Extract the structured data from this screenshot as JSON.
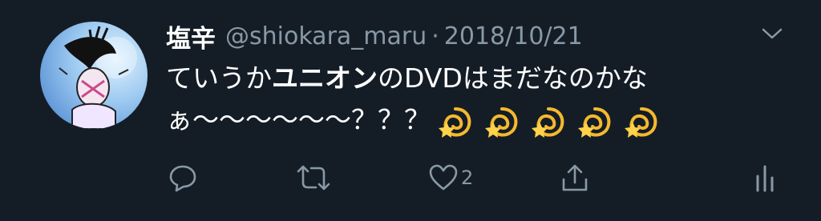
{
  "tweet": {
    "display_name": "塩辛",
    "handle": "@shiokara_maru",
    "separator": "·",
    "date": "2018/10/21",
    "text_line1_prefix": "ていうか",
    "text_line1_bold": "ユニオン",
    "text_line1_suffix": "のDVDはまだなのかな",
    "text_line2": "ぁ〜〜〜〜〜〜？？？",
    "emojis": [
      "dizzy-emoji",
      "dizzy-emoji",
      "dizzy-emoji",
      "dizzy-emoji",
      "dizzy-emoji"
    ]
  },
  "actions": {
    "reply_icon": "reply-icon",
    "retweet_icon": "retweet-icon",
    "like_icon": "heart-icon",
    "like_count": "2",
    "share_icon": "share-icon",
    "analytics_icon": "analytics-icon"
  },
  "colors": {
    "background": "#141d26",
    "text": "#ffffff",
    "secondary": "#8899a6"
  }
}
